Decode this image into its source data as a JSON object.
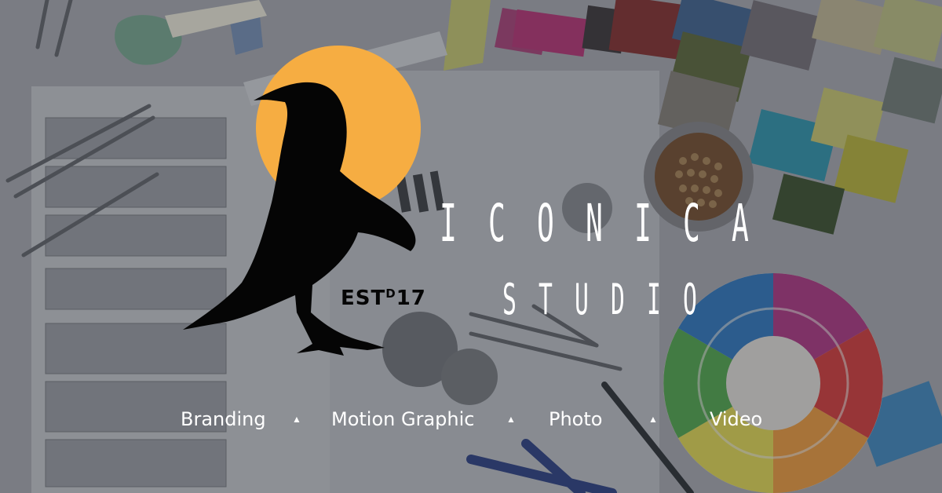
{
  "brand": {
    "name_letters": [
      "I",
      "C",
      "O",
      "N",
      "I",
      "C",
      "A"
    ],
    "sub_letters": [
      "S",
      "T",
      "U",
      "D",
      "I",
      "O"
    ],
    "established": "EST",
    "established_sup": "D",
    "established_year": "17"
  },
  "services": [
    {
      "label": "Branding"
    },
    {
      "label": "Motion Graphic"
    },
    {
      "label": "Photo"
    },
    {
      "label": "Video"
    }
  ],
  "separator_glyph": "▲",
  "colors": {
    "sun": "#f6ad42",
    "crow": "#050505",
    "text": "#ffffff",
    "background": "#8a8d93"
  }
}
